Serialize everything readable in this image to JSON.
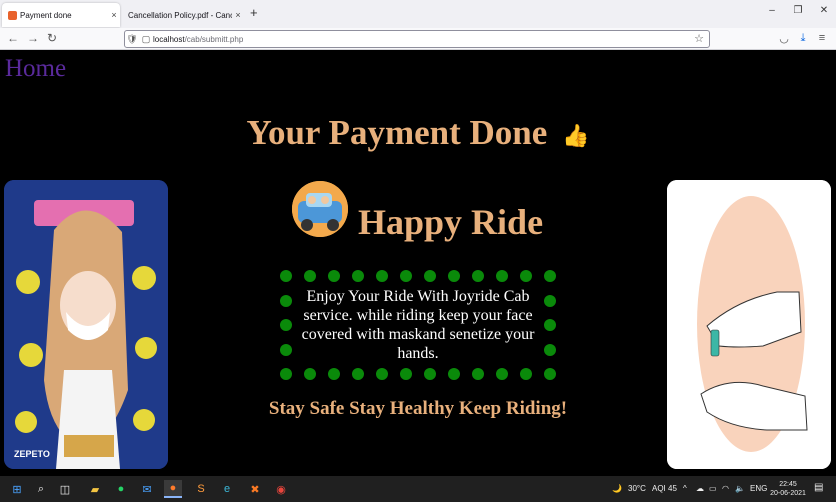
{
  "browser": {
    "tabs": [
      {
        "title": "Payment done",
        "close": "×"
      },
      {
        "title": "Cancellation Policy.pdf - Cancellatio",
        "close": "×"
      }
    ],
    "new_tab": "+",
    "window_controls": {
      "minimize": "–",
      "maximize": "❐",
      "close": "✕"
    },
    "nav": {
      "back": "←",
      "forward": "→",
      "reload": "↻"
    },
    "url": {
      "host": "localhost",
      "path": "/cab/submitt.php"
    },
    "toolbar_icons": [
      "pocket-icon",
      "download-icon",
      "menu-icon"
    ]
  },
  "page": {
    "home_link": "Home",
    "heading": "Your Payment Done",
    "happy_ride": "Happy Ride",
    "message": "Enjoy Your Ride With Joyride Cab service. while riding keep your face covered with maskand senetize your hands.",
    "tagline": "Stay Safe Stay Healthy Keep Riding!",
    "left_image_text": "ZEPETO"
  },
  "taskbar": {
    "weather": "30°C",
    "aqi": "AQI 45",
    "lang": "ENG",
    "time": "22:45",
    "date": "20-06-2021"
  },
  "colors": {
    "heading": "#e8b07c",
    "home_link": "#5a2a9c",
    "dot_border": "#0a8a0a",
    "background": "#000000"
  }
}
